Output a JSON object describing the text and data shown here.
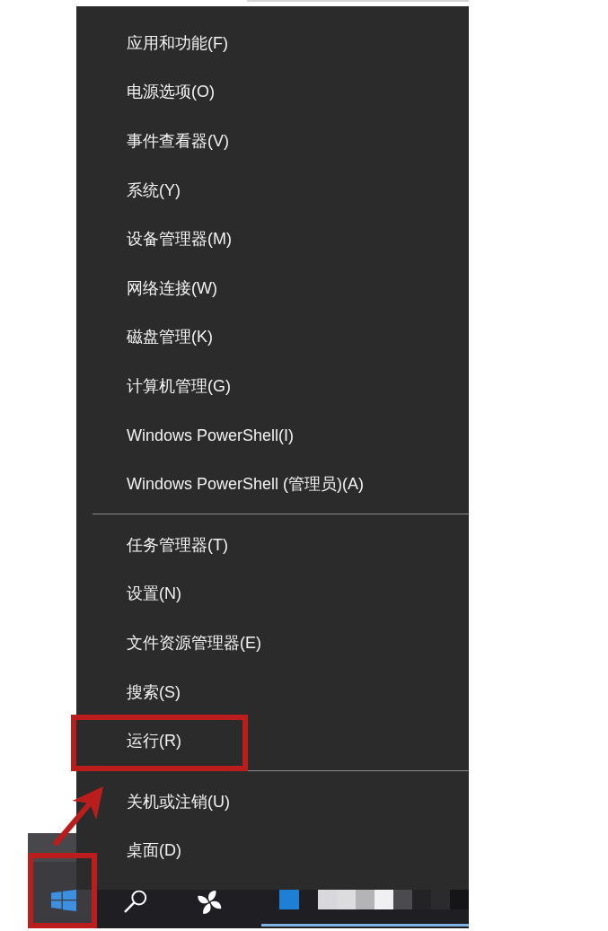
{
  "menu": {
    "sections": [
      {
        "items": [
          {
            "label": "应用和功能(F)",
            "highlighted": false
          },
          {
            "label": "电源选项(O)",
            "highlighted": false
          },
          {
            "label": "事件查看器(V)",
            "highlighted": false
          },
          {
            "label": "系统(Y)",
            "highlighted": false
          },
          {
            "label": "设备管理器(M)",
            "highlighted": false
          },
          {
            "label": "网络连接(W)",
            "highlighted": false
          },
          {
            "label": "磁盘管理(K)",
            "highlighted": false
          },
          {
            "label": "计算机管理(G)",
            "highlighted": false
          },
          {
            "label": "Windows PowerShell(I)",
            "highlighted": false
          },
          {
            "label": "Windows PowerShell (管理员)(A)",
            "highlighted": false
          }
        ]
      },
      {
        "items": [
          {
            "label": "任务管理器(T)",
            "highlighted": false
          },
          {
            "label": "设置(N)",
            "highlighted": false
          },
          {
            "label": "文件资源管理器(E)",
            "highlighted": false
          },
          {
            "label": "搜索(S)",
            "highlighted": false
          },
          {
            "label": "运行(R)",
            "highlighted": true
          }
        ]
      },
      {
        "items": [
          {
            "label": "关机或注销(U)",
            "highlighted": false
          },
          {
            "label": "桌面(D)",
            "highlighted": false
          }
        ]
      }
    ]
  },
  "taskbar": {
    "start_button": {
      "highlighted": true
    }
  }
}
